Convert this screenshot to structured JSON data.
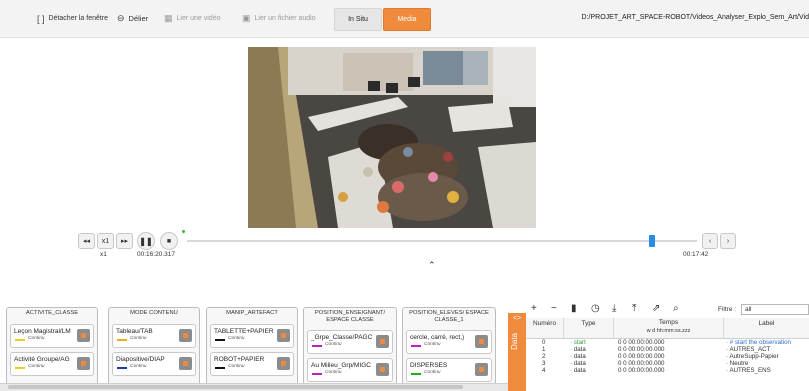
{
  "toolbar": {
    "detach": "Détacher la fenêtre",
    "unlink": "Délier",
    "link_video": "Lier une vidéo",
    "link_audio": "Lier un fichier audio",
    "mode_insitu": "In Situ",
    "mode_media": "Media",
    "path": "D:/PROJET_ART_SPACE-ROBOT/Videos_Analyser_Explo_Sem_Art/Vid"
  },
  "transport": {
    "speed": "x1",
    "speed_below": "x1",
    "current_time": "00:16:20.317",
    "end_time": "00:17:42",
    "progress": 0.912
  },
  "panels": [
    {
      "title": "ACTIVITE_CLASSE",
      "items": [
        {
          "label": "Leçon Magistral/LM",
          "sub": "Continu",
          "color": "#e6d41c"
        },
        {
          "label": "Activité Groupe/AG",
          "sub": "Continu",
          "color": "#e6d41c"
        }
      ]
    },
    {
      "title": "MODE CONTENU",
      "items": [
        {
          "label": "Tableau/TAB",
          "sub": "Continu",
          "color": "#e6b01c"
        },
        {
          "label": "Diapositive/DIAP",
          "sub": "Continu",
          "color": "#1c3ab0"
        }
      ]
    },
    {
      "title": "MANIP_ARTEFACT",
      "items": [
        {
          "label": "TABLETTE+PAPIER",
          "sub": "Continu",
          "color": "#111111"
        },
        {
          "label": "ROBOT+PAPIER",
          "sub": "Continu",
          "color": "#111111"
        }
      ]
    },
    {
      "title": "POSITION_ENSEIGNANT/ ESPACE CLASSE",
      "items": [
        {
          "label": "_Grpe_Classe/PAGC",
          "sub": "Continu",
          "color": "#c21cc2"
        },
        {
          "label": "Au Milieu_Grp/MIGC",
          "sub": "Continu",
          "color": "#c21cc2"
        }
      ]
    },
    {
      "title": "POSITION_ELEVES/ ESPACE CLASSE_1",
      "items": [
        {
          "label": "cercle, carré, rect,)",
          "sub": "Continu",
          "color": "#c21cc2"
        },
        {
          "label": "DISPERSES",
          "sub": "Continu",
          "color": "#1cb01c"
        }
      ]
    }
  ],
  "data_tab": {
    "arrows": "<>",
    "label": "Data"
  },
  "data_table": {
    "filter_label": "Filtre :",
    "filter_value": "all",
    "headers": {
      "num": "Numéro",
      "type": "Type",
      "time": "Temps",
      "time_sub": "w d hh:mm:ss.zzz",
      "label": "Label"
    },
    "rows": [
      {
        "num": "0",
        "type": "start",
        "time": "0 0 00:00:00.000",
        "label": "# start the observation"
      },
      {
        "num": "1",
        "type": "data",
        "time": "0 0 00:00:00.000",
        "label": "AUTRES_ACT"
      },
      {
        "num": "2",
        "type": "data",
        "time": "0 0 00:00:00.000",
        "label": "AutreSupp-Papier"
      },
      {
        "num": "3",
        "type": "data",
        "time": "0 0 00:00:00.000",
        "label": "Neutre"
      },
      {
        "num": "4",
        "type": "data",
        "time": "0 0 00:00:00.000",
        "label": "AUTRES_ENS"
      }
    ]
  },
  "colors": {
    "accent": "#f08a3c",
    "thumb": "#2a8be4",
    "start_green": "#2a9d3a"
  }
}
